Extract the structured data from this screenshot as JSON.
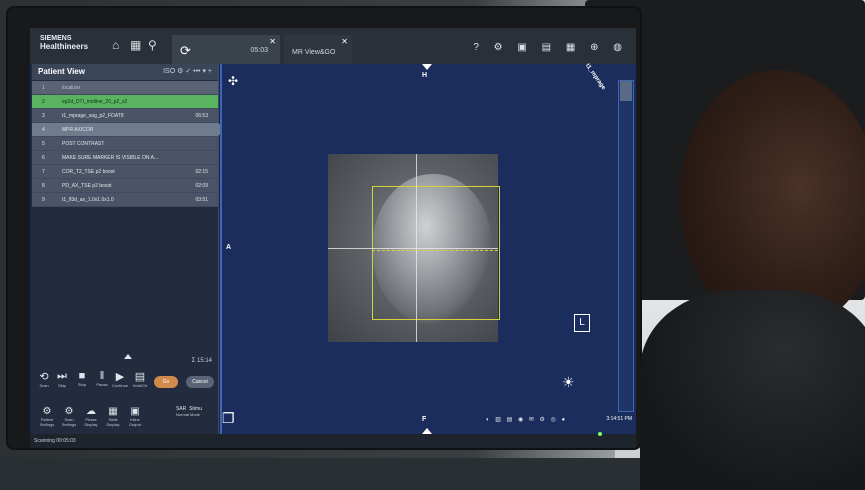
{
  "brand": {
    "line1": "SIEMENS",
    "line2": "Healthineers"
  },
  "top_bar": {
    "icons": [
      "home-icon",
      "calendar-icon",
      "patient-search-icon"
    ],
    "tabs": [
      {
        "icon": "exam-icon",
        "time": "05:03"
      },
      {
        "label": "MR View&GO"
      }
    ],
    "right_icons": [
      "help-icon",
      "layout-icon",
      "settings-icon",
      "toolbox-icon",
      "camera-icon",
      "cart-icon",
      "user-icon"
    ],
    "right_text": "? ⚙ ▣ ▤ ▦ ⊕ ◍"
  },
  "patient_view": {
    "title": "Patient View",
    "header_icons": "ISO ⚙ ✓ ••• ▾ +",
    "rows": [
      {
        "num": "1",
        "name": "localizer",
        "time": ""
      },
      {
        "num": "2",
        "name": "ep2d_DTI_midline_20_p2_s2",
        "time": ""
      },
      {
        "num": "3",
        "name": "t1_mprage_sag_p2_FOAT8",
        "time": "06:53"
      },
      {
        "num": "4",
        "name": "MPR AX/COR",
        "time": ""
      },
      {
        "num": "5",
        "name": "POST CONTRAST",
        "time": ""
      },
      {
        "num": "6",
        "name": "MAKE SURE MARKER IS VISIBLE ON A...",
        "time": ""
      },
      {
        "num": "7",
        "name": "COR_T2_TSE p2 boost",
        "time": "02:15"
      },
      {
        "num": "8",
        "name": "PD_AX_TSE p2 boost",
        "time": "02:09"
      },
      {
        "num": "9",
        "name": "t1_fl3d_ax_1.0x1.0x1.0",
        "time": "03:51"
      }
    ],
    "total_time": "Σ 15:14",
    "controls": [
      {
        "glyph": "⟲",
        "label": "Scan"
      },
      {
        "glyph": "⏭",
        "label": "Skip"
      },
      {
        "glyph": "■",
        "label": "Stop"
      },
      {
        "glyph": "‖",
        "label": "Pause"
      },
      {
        "glyph": "▶",
        "label": "Continue"
      },
      {
        "glyph": "▤",
        "label": "Hold/Cfr"
      }
    ],
    "go_label": "Go",
    "cancel_label": "Cancel",
    "bottom_tools": [
      {
        "glyph": "⚙",
        "label": "Patient Settings"
      },
      {
        "glyph": "⚙",
        "label": "Scan Settings"
      },
      {
        "glyph": "☁",
        "label": "Phase Display"
      },
      {
        "glyph": "▦",
        "label": "Table Display"
      },
      {
        "glyph": "▣",
        "label": "Inline Output"
      }
    ],
    "sar_label": "SAR",
    "stim_label": "Stimu",
    "normal_label": "Normal Mode"
  },
  "status_bar": {
    "text": "Scanning 00:05:03"
  },
  "viewer": {
    "top_label": "H",
    "left_label": "A",
    "bottom_label": "F",
    "orientation_box": "L",
    "corner_tag": "t1_mprage",
    "clock": "3:14:51 PM",
    "tray_text": "◐ ▥ ▤ ◉ ✉ ⚙ ◎ ●"
  }
}
